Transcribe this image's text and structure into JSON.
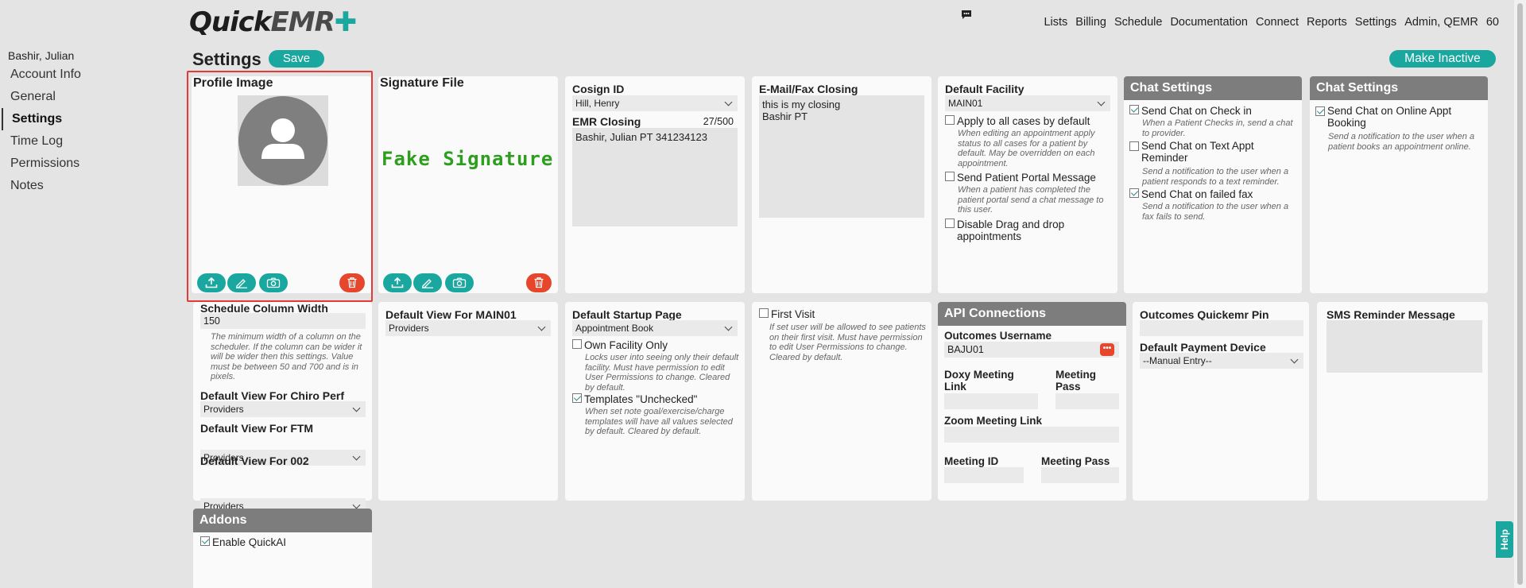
{
  "brand": {
    "quick": "Quick",
    "emr": "EMR",
    "cross": "✚"
  },
  "topnav": {
    "items": [
      "Lists",
      "Billing",
      "Schedule",
      "Documentation",
      "Connect",
      "Reports",
      "Settings"
    ],
    "user": "Admin, QEMR",
    "count": "60"
  },
  "sidebar": {
    "user": "Bashir, Julian",
    "items": [
      "Account Info",
      "General",
      "Settings",
      "Time Log",
      "Permissions",
      "Notes"
    ],
    "active": "Settings"
  },
  "page": {
    "title": "Settings",
    "save_label": "Save",
    "inactive_label": "Make Inactive",
    "help_label": "Help"
  },
  "profile": {
    "title": "Profile Image"
  },
  "signature": {
    "title": "Signature File",
    "sample": "Fake Signature"
  },
  "cosign": {
    "title": "Cosign ID",
    "value": "Hill, Henry",
    "emr_title": "EMR Closing",
    "emr_count": "27/500",
    "emr_text": "Bashir, Julian PT 341234123"
  },
  "email_closing": {
    "title": "E-Mail/Fax Closing",
    "text": "this is my closing\nBashir PT"
  },
  "facility": {
    "title": "Default Facility",
    "value": "MAIN01",
    "options": [
      {
        "label": "Apply to all cases by default",
        "checked": false,
        "help": "When editing an appointment apply status to all cases for a patient by default. May be overridden on each appointment."
      },
      {
        "label": "Send Patient Portal Message",
        "checked": false,
        "help": "When a patient has completed the patient portal send a chat message to this user."
      },
      {
        "label": "Disable Drag and drop appointments",
        "checked": false,
        "help": ""
      }
    ]
  },
  "chat1": {
    "title": "Chat Settings",
    "options": [
      {
        "label": "Send Chat on Check in",
        "checked": true,
        "help": "When a Patient Checks in, send a chat to provider."
      },
      {
        "label": "Send Chat on Text Appt Reminder",
        "checked": false,
        "help": "Send a notification to the user when a patient responds to a text reminder."
      },
      {
        "label": "Send Chat on failed fax",
        "checked": true,
        "help": "Send a notification to the user when a fax fails to send."
      }
    ]
  },
  "chat2": {
    "title": "Chat Settings",
    "options": [
      {
        "label": "Send Chat on Online Appt Booking",
        "checked": true,
        "help": "Send a notification to the user when a patient books an appointment online."
      }
    ]
  },
  "schedule": {
    "title": "Schedule Column Width",
    "value": "150",
    "help": "The minimum width of a column on the scheduler. If the column can be wider it will be wider then this settings. Value must be between 50 and 700 and is in pixels.",
    "views": [
      {
        "label": "Default View For Chiro Perf",
        "value": "Providers"
      },
      {
        "label": "Default View For FTM",
        "value": "Providers"
      },
      {
        "label": "Default View For 002",
        "value": "Providers"
      }
    ]
  },
  "main01": {
    "title": "Default View For MAIN01",
    "value": "Providers"
  },
  "startup": {
    "title": "Default Startup Page",
    "value": "Appointment Book",
    "options": [
      {
        "label": "Own Facility Only",
        "checked": false,
        "help": "Locks user into seeing only their default facility. Must have permission to edit User Permissions to change. Cleared by default."
      },
      {
        "label": "Templates \"Unchecked\"",
        "checked": true,
        "help": "When set note goal/exercise/charge templates will have all values selected by default. Cleared by default."
      }
    ]
  },
  "first_visit": {
    "label": "First Visit",
    "checked": false,
    "help": "If set user will be allowed to see patients on their first visit. Must have permission to edit User Permissions to change. Cleared by default."
  },
  "api": {
    "title": "API Connections",
    "outcomes_label": "Outcomes Username",
    "outcomes_value": "BAJU01",
    "doxy_label": "Doxy Meeting Link",
    "doxy_pass_label": "Meeting Pass",
    "zoom_label": "Zoom Meeting Link",
    "meeting_id_label": "Meeting ID",
    "meeting_pass_label": "Meeting Pass"
  },
  "pin": {
    "title": "Outcomes Quickemr Pin",
    "payment_label": "Default Payment Device",
    "payment_value": "--Manual Entry--"
  },
  "sms": {
    "title": "SMS Reminder Message"
  },
  "addons": {
    "title": "Addons",
    "options": [
      {
        "label": "Enable QuickAI",
        "checked": true
      }
    ]
  },
  "colors": {
    "accent": "#1aa7a0",
    "danger": "#e5462c",
    "header_grey": "#7d7d7d",
    "highlight": "#e53935",
    "signature": "#2e9e1f"
  }
}
